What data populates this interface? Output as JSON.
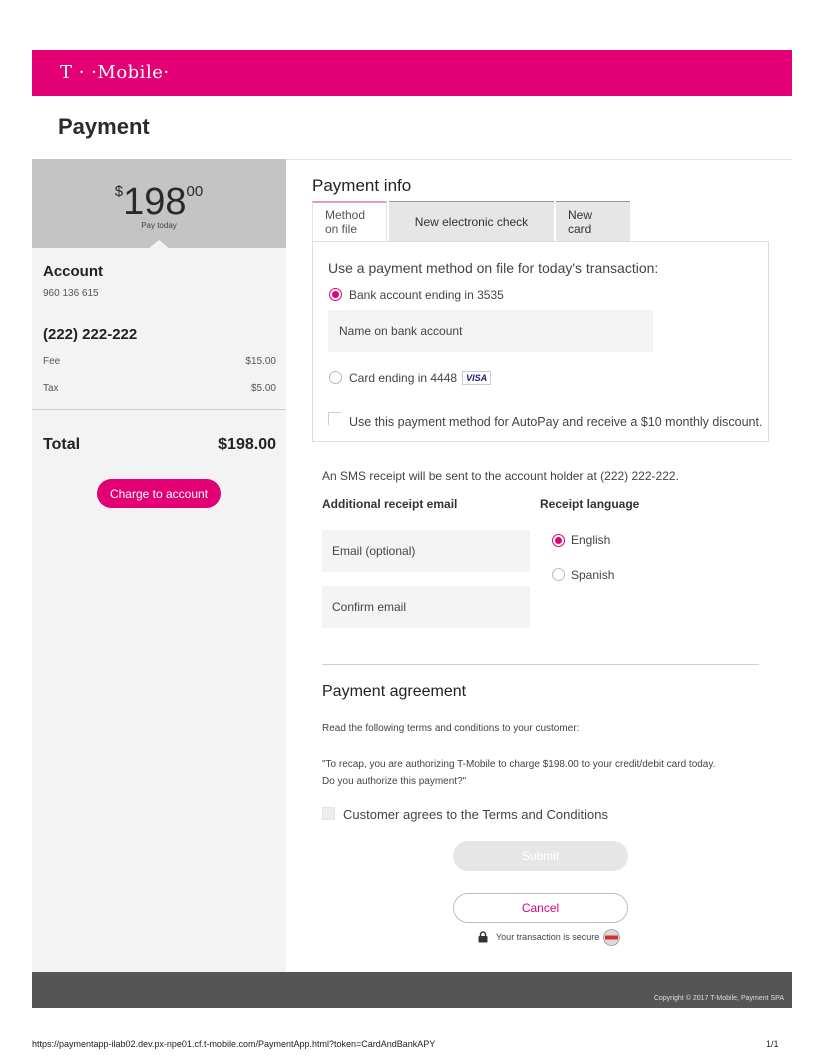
{
  "header": {
    "brand": "T · ·Mobile·"
  },
  "page": {
    "title": "Payment"
  },
  "summary": {
    "currency_symbol": "$",
    "amount_dollars": "198",
    "amount_cents": "00",
    "pay_today_label": "Pay today",
    "account_label": "Account",
    "account_number": "960 136 615",
    "phone_number": "(222) 222-222",
    "fee_label": "Fee",
    "fee_value": "$15.00",
    "tax_label": "Tax",
    "tax_value": "$5.00",
    "total_label": "Total",
    "total_value": "$198.00",
    "charge_button": "Charge to account"
  },
  "payment_info": {
    "title": "Payment info",
    "tabs": [
      {
        "label": "Method on file",
        "active": true
      },
      {
        "label": "New electronic check",
        "active": false
      },
      {
        "label": "New card",
        "active": false
      }
    ],
    "heading": "Use a payment method on file for today's transaction:",
    "options": [
      {
        "label": "Bank account ending in 3535",
        "selected": true
      },
      {
        "label": "Card ending in 4448",
        "card_brand": "VISA",
        "selected": false
      }
    ],
    "name_placeholder": "Name on bank account",
    "autopay_label": "Use this payment method for AutoPay and receive a $10 monthly discount."
  },
  "receipt": {
    "sms_note": "An SMS receipt will be sent to the account holder at (222) 222-222.",
    "email_heading": "Additional receipt email",
    "email_placeholder": "Email (optional)",
    "confirm_placeholder": "Confirm email",
    "language_heading": "Receipt language",
    "languages": [
      {
        "label": "English",
        "selected": true
      },
      {
        "label": "Spanish",
        "selected": false
      }
    ]
  },
  "agreement": {
    "title": "Payment agreement",
    "instruction": "Read the following terms and conditions to your customer:",
    "quote_line1": "\"To recap, you are authorizing T-Mobile to charge $198.00 to your credit/debit card today.",
    "quote_line2": "Do you authorize this payment?\"",
    "checkbox_label": "Customer agrees to the Terms and Conditions"
  },
  "actions": {
    "submit": "Submit",
    "cancel": "Cancel",
    "secure_note": "Your transaction is secure"
  },
  "footer": {
    "copyright": "Copyright © 2017 T-Mobile, Payment SPA"
  },
  "print_meta": {
    "url": "https://paymentapp-ilab02.dev.px-npe01.cf.t-mobile.com/PaymentApp.html?token=CardAndBankAPY",
    "page": "1/1"
  },
  "colors": {
    "brand": "#e20074",
    "footer": "#555555",
    "sidebar": "#f3f3f3",
    "amount_box": "#c4c4c4"
  },
  "icons": {
    "lock": "lock-icon",
    "seal": "security-seal-icon",
    "visa": "visa-card-icon"
  }
}
